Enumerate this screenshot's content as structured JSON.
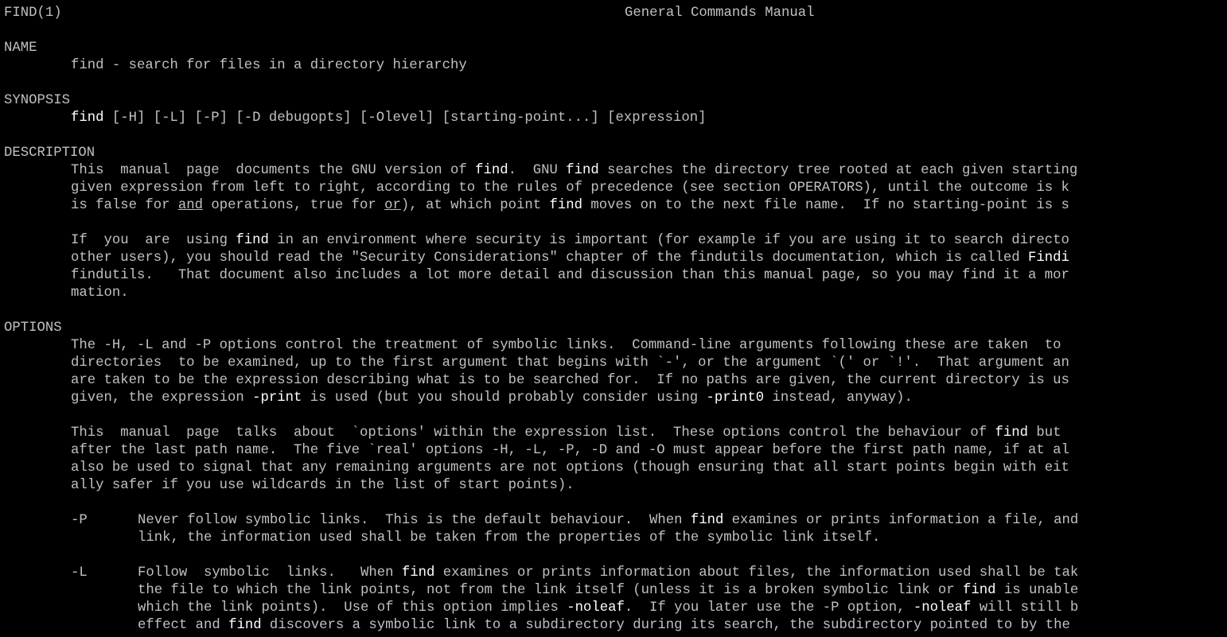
{
  "header": {
    "left": "FIND(1)",
    "center": "General Commands Manual"
  },
  "name": {
    "heading": "NAME",
    "text": "find - search for files in a directory hierarchy"
  },
  "synopsis": {
    "heading": "SYNOPSIS",
    "cmd": "find",
    "rest": " [-H] [-L] [-P] [-D debugopts] [-Olevel] [starting-point...] [expression]"
  },
  "description": {
    "heading": "DESCRIPTION",
    "p1": {
      "l1a": "This  manual  page  documents the GNU version of ",
      "l1b": "find",
      "l1c": ".  GNU ",
      "l1d": "find",
      "l1e": " searches the directory tree rooted at each given starting",
      "l2": "given expression from left to right, according to the rules of precedence (see section OPERATORS), until the outcome is k",
      "l3a": "is false for ",
      "l3b": "and",
      "l3c": " operations, true for ",
      "l3d": "or",
      "l3e": "), at which point ",
      "l3f": "find",
      "l3g": " moves on to the next file name.  If no starting-point is s"
    },
    "p2": {
      "l1a": "If  you  are  using ",
      "l1b": "find",
      "l1c": " in an environment where security is important (for example if you are using it to search directo",
      "l2a": "other users), you should read the \"Security Considerations\" chapter of the findutils documentation, which is called ",
      "l2b": "Findi",
      "l3": "findutils.   That document also includes a lot more detail and discussion than this manual page, so you may find it a mor",
      "l4": "mation."
    }
  },
  "options": {
    "heading": "OPTIONS",
    "p1": {
      "l1": "The -H, -L and -P options control the treatment of symbolic links.  Command-line arguments following these are taken  to",
      "l2": "directories  to be examined, up to the first argument that begins with `-', or the argument `(' or `!'.  That argument an",
      "l3": "are taken to be the expression describing what is to be searched for.  If no paths are given, the current directory is us",
      "l4a": "given, the expression ",
      "l4b": "-print",
      "l4c": " is used (but you should probably consider using ",
      "l4d": "-print0",
      "l4e": " instead, anyway)."
    },
    "p2": {
      "l1a": "This  manual  page  talks  about  `options' within the expression list.  These options control the behaviour of ",
      "l1b": "find",
      "l1c": " but",
      "l2": "after the last path name.  The five `real' options -H, -L, -P, -D and -O must appear before the first path name, if at al",
      "l3": "also be used to signal that any remaining arguments are not options (though ensuring that all start points begin with eit",
      "l4": "ally safer if you use wildcards in the list of start points)."
    },
    "optP": {
      "flag": "-P",
      "l1a": "Never follow symbolic links.  This is the default behaviour.  When ",
      "l1b": "find",
      "l1c": " examines or prints information a file, and",
      "l2": "link, the information used shall be taken from the properties of the symbolic link itself."
    },
    "optL": {
      "flag": "-L",
      "l1a": "Follow  symbolic  links.   When ",
      "l1b": "find",
      "l1c": " examines or prints information about files, the information used shall be tak",
      "l2a": "the file to which the link points, not from the link itself (unless it is a broken symbolic link or ",
      "l2b": "find",
      "l2c": " is unable",
      "l3a": "which the link points).  Use of this option implies ",
      "l3b": "-noleaf",
      "l3c": ".  If you later use the -P option, ",
      "l3d": "-noleaf",
      "l3e": " will still b",
      "l4a": "effect and ",
      "l4b": "find",
      "l4c": " discovers a symbolic link to a subdirectory during its search, the subdirectory pointed to by the"
    }
  }
}
